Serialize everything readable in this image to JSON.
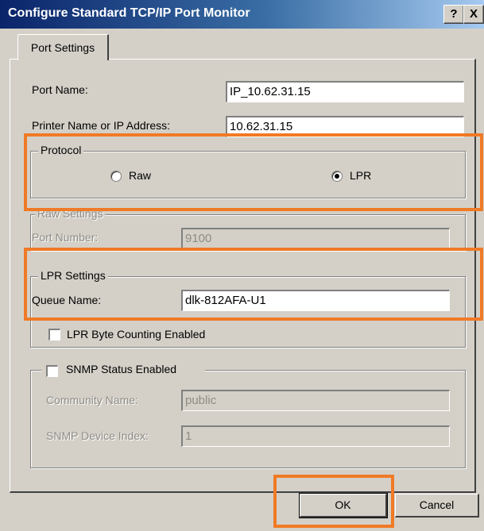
{
  "window": {
    "title": "Configure Standard TCP/IP Port Monitor",
    "help_button_label": "?",
    "close_button_label": "X"
  },
  "tabs": [
    {
      "label": "Port Settings",
      "selected": true
    }
  ],
  "port_name": {
    "label": "Port Name:",
    "value": "IP_10.62.31.15"
  },
  "printer_address": {
    "label": "Printer Name or IP Address:",
    "value": "10.62.31.15"
  },
  "protocol": {
    "legend": "Protocol",
    "options": [
      {
        "label": "Raw",
        "selected": false
      },
      {
        "label": "LPR",
        "selected": true
      }
    ]
  },
  "raw_settings": {
    "legend": "Raw Settings",
    "port_number_label": "Port Number:",
    "port_number_value": "9100"
  },
  "lpr_settings": {
    "legend": "LPR Settings",
    "queue_name_label": "Queue Name:",
    "queue_name_value": "dlk-812AFA-U1",
    "byte_counting_label": "LPR Byte Counting Enabled",
    "byte_counting_checked": false
  },
  "snmp": {
    "legend": "SNMP Status Enabled",
    "checked": false,
    "community_name_label": "Community Name:",
    "community_name_value": "public",
    "device_index_label": "SNMP Device Index:",
    "device_index_value": "1"
  },
  "buttons": {
    "ok": "OK",
    "cancel": "Cancel"
  },
  "colors": {
    "highlight": "#f07a26",
    "titlebar_start": "#0a246a",
    "titlebar_end": "#a6caf0",
    "dialog_face": "#d4d0c8"
  }
}
